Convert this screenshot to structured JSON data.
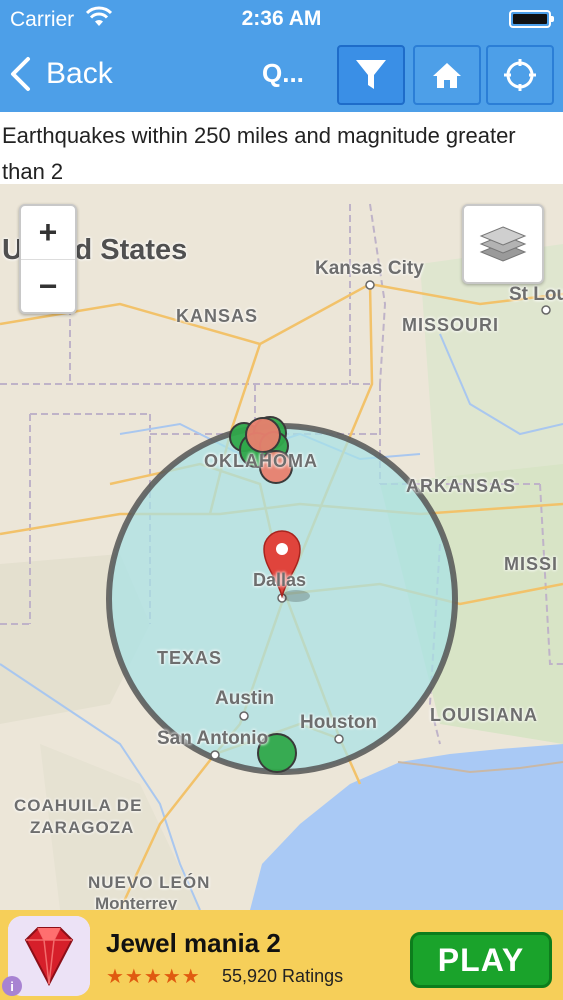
{
  "status_bar": {
    "carrier": "Carrier",
    "time": "2:36 AM"
  },
  "nav": {
    "back_label": "Back",
    "title": "Q...",
    "icons": [
      "filter-icon",
      "home-icon",
      "locate-icon"
    ]
  },
  "description": "Earthquakes within 250 miles and magnitude greater than 2",
  "map": {
    "labels": {
      "country": "United States",
      "kansas_city": "Kansas City",
      "st_louis": "St Lou",
      "kansas": "KANSAS",
      "missouri": "MISSOURI",
      "oklahoma": "OKLAHOMA",
      "arkansas": "ARKANSAS",
      "mississippi": "MISSI",
      "dallas": "Dallas",
      "texas": "TEXAS",
      "austin": "Austin",
      "houston": "Houston",
      "louisiana": "LOUISIANA",
      "san_antonio": "San Antonio",
      "coahuila": "COAHUILA DE",
      "zaragoza": "ZARAGOZA",
      "nuevo_leon": "NUEVO LEÓN",
      "monterrey": "Monterrey"
    },
    "zoom_in": "+",
    "zoom_out": "−",
    "colors": {
      "radius_fill": "#a7e2e6",
      "quake_green": "#2fa84a",
      "quake_red": "#e8806e",
      "pin": "#e0443c"
    }
  },
  "ad": {
    "title": "Jewel mania 2",
    "stars": "★★★★★",
    "rating_value": 4.5,
    "ratings": "55,920 Ratings",
    "play_label": "PLAY"
  }
}
